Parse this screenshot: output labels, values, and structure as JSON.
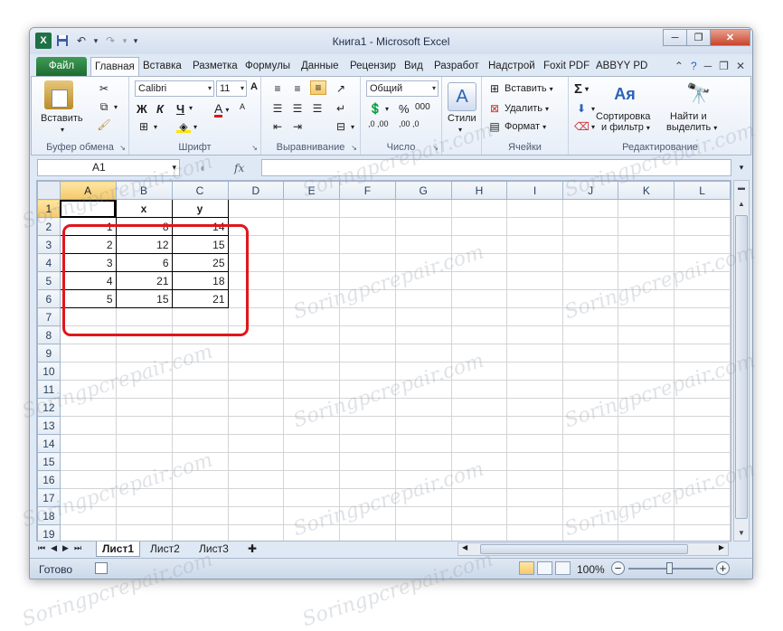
{
  "window": {
    "title": "Книга1 - Microsoft Excel",
    "controls": {
      "minimize": "─",
      "restore": "❐",
      "close": "✕"
    }
  },
  "qat": {
    "undo": "↶",
    "redo": "↷",
    "customize": "▾"
  },
  "tabs": [
    {
      "label": "Файл",
      "active": false
    },
    {
      "label": "Главная",
      "active": true
    },
    {
      "label": "Вставка",
      "active": false
    },
    {
      "label": "Разметка",
      "active": false
    },
    {
      "label": "Формулы",
      "active": false
    },
    {
      "label": "Данные",
      "active": false
    },
    {
      "label": "Рецензир",
      "active": false
    },
    {
      "label": "Вид",
      "active": false
    },
    {
      "label": "Разработ",
      "active": false
    },
    {
      "label": "Надстрой",
      "active": false
    },
    {
      "label": "Foxit PDF",
      "active": false
    },
    {
      "label": "ABBYY PD",
      "active": false
    }
  ],
  "ribbon": {
    "clipboard": {
      "label": "Буфер обмена",
      "paste": "Вставить"
    },
    "font": {
      "label": "Шрифт",
      "name": "Calibri",
      "size": "11",
      "bold": "Ж",
      "italic": "К",
      "underline": "Ч",
      "grow": "A",
      "shrink": "A"
    },
    "alignment": {
      "label": "Выравнивание"
    },
    "number": {
      "label": "Число",
      "format": "Общий",
      "percent": "%",
      "thousands": "000",
      "inc_dec": ",0 ,00",
      "dec_dec": ",00 ,0"
    },
    "styles": {
      "label": "Стили"
    },
    "cells": {
      "label": "Ячейки",
      "insert": "Вставить",
      "delete": "Удалить",
      "format": "Формат"
    },
    "editing": {
      "label": "Редактирование",
      "sum": "Σ",
      "sort_line1": "Сортировка",
      "sort_line2": "и фильтр",
      "find_line1": "Найти и",
      "find_line2": "выделить"
    }
  },
  "formula_bar": {
    "name_box": "A1",
    "fx": "fx",
    "value": ""
  },
  "columns": [
    "A",
    "B",
    "C",
    "D",
    "E",
    "F",
    "G",
    "H",
    "I",
    "J",
    "K",
    "L"
  ],
  "rows": [
    [
      "",
      "x",
      "y"
    ],
    [
      "1",
      "8",
      "14"
    ],
    [
      "2",
      "12",
      "15"
    ],
    [
      "3",
      "6",
      "25"
    ],
    [
      "4",
      "21",
      "18"
    ],
    [
      "5",
      "15",
      "21"
    ],
    [],
    [],
    [],
    [],
    [],
    [],
    [],
    [],
    [],
    [],
    [],
    [],
    []
  ],
  "row_numbers": [
    "1",
    "2",
    "3",
    "4",
    "5",
    "6",
    "7",
    "8",
    "9",
    "10",
    "11",
    "12",
    "13",
    "14",
    "15",
    "16",
    "17",
    "18",
    "19"
  ],
  "sheets": [
    {
      "label": "Лист1",
      "active": true
    },
    {
      "label": "Лист2",
      "active": false
    },
    {
      "label": "Лист3",
      "active": false
    }
  ],
  "status": {
    "ready": "Готово",
    "zoom": "100%",
    "zoom_out": "−",
    "zoom_in": "+"
  },
  "watermark": "Soringpcrepair.com",
  "colors": {
    "highlight": "#e0161c",
    "file_tab": "#2a7f41",
    "selection": "#f5c86a"
  }
}
